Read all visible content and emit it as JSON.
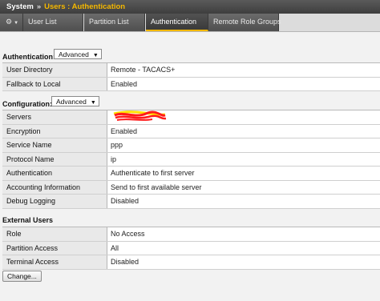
{
  "breadcrumb": {
    "root": "System",
    "separator": "»",
    "current": "Users : Authentication"
  },
  "tabs": [
    {
      "label": "User List"
    },
    {
      "label": "Partition List"
    },
    {
      "label": "Authentication"
    },
    {
      "label": "Remote Role Groups"
    }
  ],
  "authentication": {
    "heading": "Authentication:",
    "mode": "Advanced",
    "rows": [
      {
        "label": "User Directory",
        "value": "Remote - TACACS+"
      },
      {
        "label": "Fallback to Local",
        "value": "Enabled"
      }
    ]
  },
  "configuration": {
    "heading": "Configuration:",
    "mode": "Advanced",
    "servers_label": "Servers",
    "rows": [
      {
        "label": "Encryption",
        "value": "Enabled"
      },
      {
        "label": "Service Name",
        "value": "ppp"
      },
      {
        "label": "Protocol Name",
        "value": "ip"
      },
      {
        "label": "Authentication",
        "value": "Authenticate to first server"
      },
      {
        "label": "Accounting Information",
        "value": "Send to first available server"
      },
      {
        "label": "Debug Logging",
        "value": "Disabled"
      }
    ]
  },
  "external_users": {
    "heading": "External Users",
    "rows": [
      {
        "label": "Role",
        "value": "No Access"
      },
      {
        "label": "Partition Access",
        "value": "All"
      },
      {
        "label": "Terminal Access",
        "value": "Disabled"
      }
    ]
  },
  "change_button": "Change...",
  "colors": {
    "accent": "#f5b800",
    "redaction": "#ff1a1a",
    "redaction_under": "#ffe000"
  },
  "icons": {
    "settings": "gear-icon",
    "dropdown": "chevron-down-icon"
  }
}
